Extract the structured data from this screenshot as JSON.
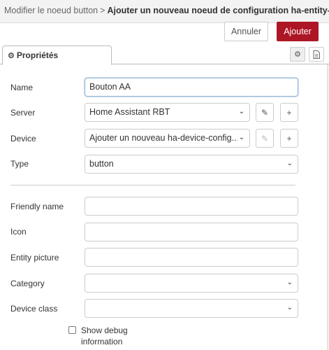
{
  "header": {
    "breadcrumb": "Modifier le noeud button",
    "separator": ">",
    "title": "Ajouter un nouveau noeud de configuration ha-entity-config"
  },
  "toolbar": {
    "cancel_label": "Annuler",
    "add_label": "Ajouter"
  },
  "tabs": {
    "properties_label": "Propriétés",
    "icons": [
      "gear-icon",
      "document-icon"
    ]
  },
  "form": {
    "name_label": "Name",
    "name_value": "Bouton AA",
    "server_label": "Server",
    "server_value": "Home Assistant RBT",
    "device_label": "Device",
    "device_value": "Ajouter un nouveau ha-device-config...",
    "type_label": "Type",
    "type_value": "button",
    "friendly_name_label": "Friendly name",
    "friendly_name_value": "",
    "icon_label": "Icon",
    "icon_value": "",
    "entity_picture_label": "Entity picture",
    "entity_picture_value": "",
    "category_label": "Category",
    "category_value": "",
    "device_class_label": "Device class",
    "device_class_value": "",
    "debug_label": "Show debug information",
    "debug_checked": false
  },
  "colors": {
    "primary_button": "#ad1625",
    "header_bg": "#f3f3f3"
  }
}
